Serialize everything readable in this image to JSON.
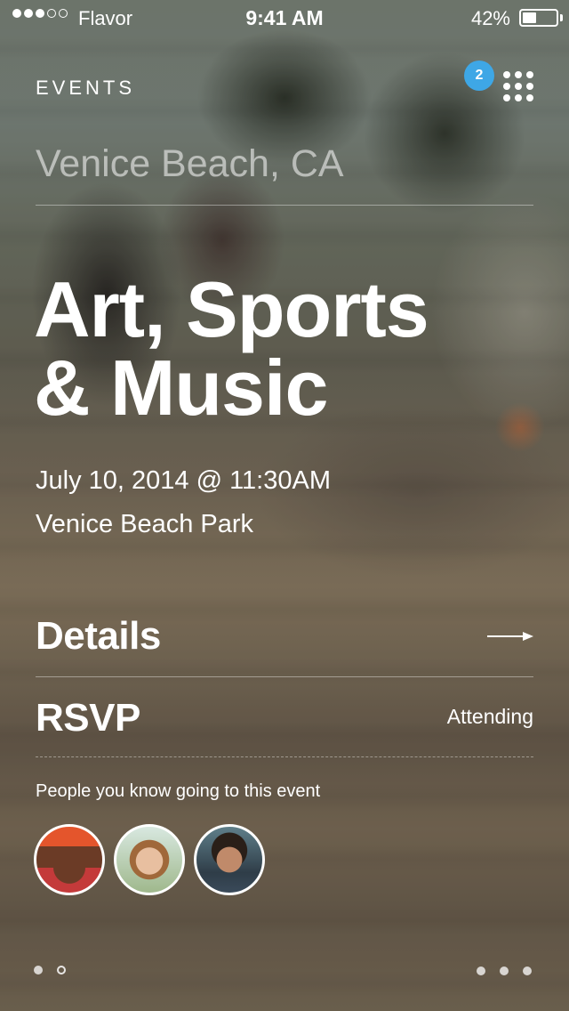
{
  "status_bar": {
    "carrier": "Flavor",
    "time": "9:41 AM",
    "battery_percent": "42%",
    "battery_level": 0.42,
    "signal_strength": 3,
    "signal_max": 5
  },
  "header": {
    "section_title": "EVENTS",
    "notification_count": "2",
    "menu_icon": "grid-menu-icon"
  },
  "event": {
    "location": "Venice Beach, CA",
    "title_line1": "Art, Sports",
    "title_line2": "& Music",
    "datetime": "July 10, 2014 @ 11:30AM",
    "venue": "Venice Beach Park"
  },
  "actions": {
    "details_label": "Details",
    "details_icon": "arrow-right-icon",
    "rsvp_label": "RSVP",
    "rsvp_status": "Attending"
  },
  "friends": {
    "label": "People you know going to this event",
    "avatars": [
      "avatar-1",
      "avatar-2",
      "avatar-3"
    ]
  },
  "pager": {
    "current_page": 1,
    "total_pages": 2
  },
  "colors": {
    "badge": "#3ea7e6",
    "text": "#ffffff"
  }
}
